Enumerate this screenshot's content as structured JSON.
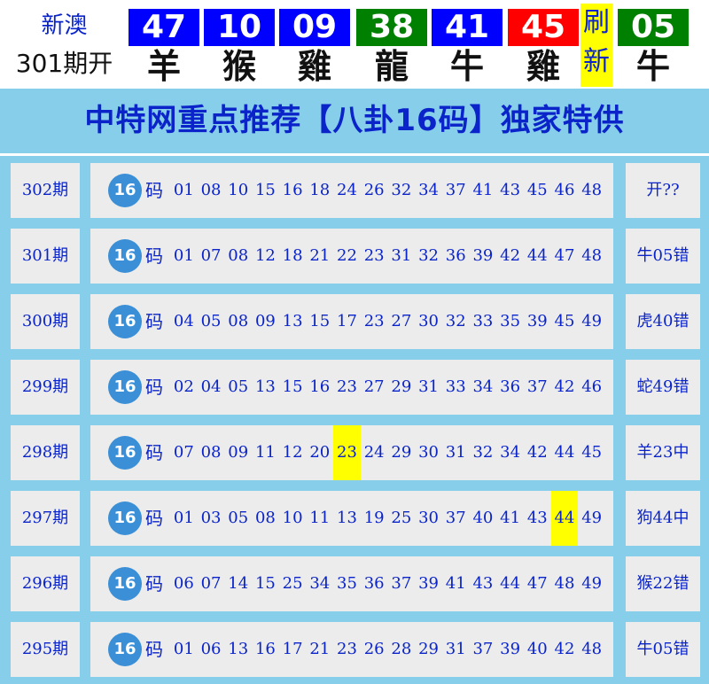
{
  "header": {
    "lottery_name": "新澳",
    "period_open": "301期开",
    "balls": [
      {
        "num": "47",
        "zodiac": "羊",
        "color": "#0000ff"
      },
      {
        "num": "10",
        "zodiac": "猴",
        "color": "#0000ff"
      },
      {
        "num": "09",
        "zodiac": "雞",
        "color": "#0000ff"
      },
      {
        "num": "38",
        "zodiac": "龍",
        "color": "#008000"
      },
      {
        "num": "41",
        "zodiac": "牛",
        "color": "#0000ff"
      },
      {
        "num": "45",
        "zodiac": "雞",
        "color": "#ff0000"
      }
    ],
    "refresh": [
      "刷",
      "新"
    ],
    "special": {
      "num": "05",
      "zodiac": "牛",
      "color": "#008000"
    }
  },
  "title": "中特网重点推荐【八卦16码】独家特供",
  "badge_label": "16",
  "ma_label": "码",
  "rows": [
    {
      "period": "302期",
      "numbers": [
        "01",
        "08",
        "10",
        "15",
        "16",
        "18",
        "24",
        "26",
        "32",
        "34",
        "37",
        "41",
        "43",
        "45",
        "46",
        "48"
      ],
      "hit_index": -1,
      "result": "开??"
    },
    {
      "period": "301期",
      "numbers": [
        "01",
        "07",
        "08",
        "12",
        "18",
        "21",
        "22",
        "23",
        "31",
        "32",
        "36",
        "39",
        "42",
        "44",
        "47",
        "48"
      ],
      "hit_index": -1,
      "result": "牛05错"
    },
    {
      "period": "300期",
      "numbers": [
        "04",
        "05",
        "08",
        "09",
        "13",
        "15",
        "17",
        "23",
        "27",
        "30",
        "32",
        "33",
        "35",
        "39",
        "45",
        "49"
      ],
      "hit_index": -1,
      "result": "虎40错"
    },
    {
      "period": "299期",
      "numbers": [
        "02",
        "04",
        "05",
        "13",
        "15",
        "16",
        "23",
        "27",
        "29",
        "31",
        "33",
        "34",
        "36",
        "37",
        "42",
        "46"
      ],
      "hit_index": -1,
      "result": "蛇49错"
    },
    {
      "period": "298期",
      "numbers": [
        "07",
        "08",
        "09",
        "11",
        "12",
        "20",
        "23",
        "24",
        "29",
        "30",
        "31",
        "32",
        "34",
        "42",
        "44",
        "45"
      ],
      "hit_index": 6,
      "result": "羊23中"
    },
    {
      "period": "297期",
      "numbers": [
        "01",
        "03",
        "05",
        "08",
        "10",
        "11",
        "13",
        "19",
        "25",
        "30",
        "37",
        "40",
        "41",
        "43",
        "44",
        "49"
      ],
      "hit_index": 14,
      "result": "狗44中"
    },
    {
      "period": "296期",
      "numbers": [
        "06",
        "07",
        "14",
        "15",
        "25",
        "34",
        "35",
        "36",
        "37",
        "39",
        "41",
        "43",
        "44",
        "47",
        "48",
        "49"
      ],
      "hit_index": -1,
      "result": "猴22错"
    },
    {
      "period": "295期",
      "numbers": [
        "01",
        "06",
        "13",
        "16",
        "17",
        "21",
        "23",
        "26",
        "28",
        "29",
        "31",
        "37",
        "39",
        "40",
        "42",
        "48"
      ],
      "hit_index": -1,
      "result": "牛05错"
    }
  ]
}
